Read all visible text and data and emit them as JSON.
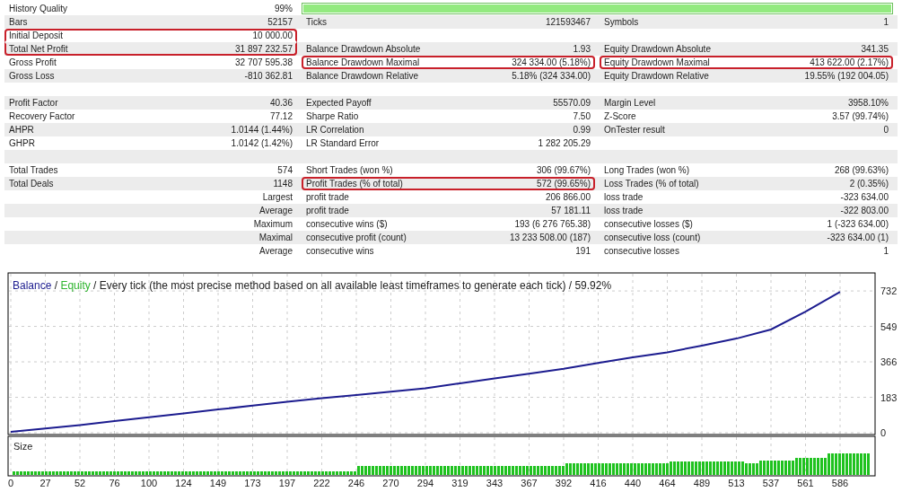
{
  "report": {
    "rows": [
      {
        "cells": [
          {
            "kind": "stat",
            "label": "History Quality",
            "value": "99%",
            "highlighted": false
          },
          {
            "kind": "bar",
            "level": 1
          }
        ]
      },
      {
        "cells": [
          {
            "kind": "stat",
            "label": "Bars",
            "value": "52157",
            "highlighted": false
          },
          {
            "kind": "stat",
            "label": "Ticks",
            "value": "121593467",
            "highlighted": false
          },
          {
            "kind": "stat",
            "label": "Symbols",
            "value": "1",
            "highlighted": false
          }
        ]
      },
      {
        "cells": [
          {
            "kind": "stat",
            "label": "Initial Deposit",
            "value": "10 000.00",
            "highlighted": true
          },
          {
            "kind": "blank"
          },
          {
            "kind": "blank"
          }
        ]
      },
      {
        "cells": [
          {
            "kind": "stat",
            "label": "Total Net Profit",
            "value": "31 897 232.57",
            "highlighted": true
          },
          {
            "kind": "stat",
            "label": "Balance Drawdown Absolute",
            "value": "1.93",
            "highlighted": false
          },
          {
            "kind": "stat",
            "label": "Equity Drawdown Absolute",
            "value": "341.35",
            "highlighted": false
          }
        ]
      },
      {
        "cells": [
          {
            "kind": "stat",
            "label": "Gross Profit",
            "value": "32 707 595.38",
            "highlighted": false
          },
          {
            "kind": "stat",
            "label": "Balance Drawdown Maximal",
            "value": "324 334.00 (5.18%)",
            "highlighted": true
          },
          {
            "kind": "stat",
            "label": "Equity Drawdown Maximal",
            "value": "413 622.00 (2.17%)",
            "highlighted": true
          }
        ]
      },
      {
        "cells": [
          {
            "kind": "stat",
            "label": "Gross Loss",
            "value": "-810 362.81",
            "highlighted": false
          },
          {
            "kind": "stat",
            "label": "Balance Drawdown Relative",
            "value": "5.18% (324 334.00)",
            "highlighted": false
          },
          {
            "kind": "stat",
            "label": "Equity Drawdown Relative",
            "value": "19.55% (192 004.05)",
            "highlighted": false
          }
        ]
      },
      {
        "cells": [
          {
            "kind": "blank"
          },
          {
            "kind": "blank"
          },
          {
            "kind": "blank"
          }
        ]
      },
      {
        "cells": [
          {
            "kind": "stat",
            "label": "Profit Factor",
            "value": "40.36",
            "highlighted": false
          },
          {
            "kind": "stat",
            "label": "Expected Payoff",
            "value": "55570.09",
            "highlighted": false
          },
          {
            "kind": "stat",
            "label": "Margin Level",
            "value": "3958.10%",
            "highlighted": false
          }
        ]
      },
      {
        "cells": [
          {
            "kind": "stat",
            "label": "Recovery Factor",
            "value": "77.12",
            "highlighted": false
          },
          {
            "kind": "stat",
            "label": "Sharpe Ratio",
            "value": "7.50",
            "highlighted": false
          },
          {
            "kind": "stat",
            "label": "Z-Score",
            "value": "3.57 (99.74%)",
            "highlighted": false
          }
        ]
      },
      {
        "cells": [
          {
            "kind": "stat",
            "label": "AHPR",
            "value": "1.0144 (1.44%)",
            "highlighted": false
          },
          {
            "kind": "stat",
            "label": "LR Correlation",
            "value": "0.99",
            "highlighted": false
          },
          {
            "kind": "stat",
            "label": "OnTester result",
            "value": "0",
            "highlighted": false
          }
        ]
      },
      {
        "cells": [
          {
            "kind": "stat",
            "label": "GHPR",
            "value": "1.0142 (1.42%)",
            "highlighted": false
          },
          {
            "kind": "stat",
            "label": "LR Standard Error",
            "value": "1 282 205.29",
            "highlighted": false
          },
          {
            "kind": "blank"
          }
        ]
      },
      {
        "cells": [
          {
            "kind": "blank"
          },
          {
            "kind": "blank"
          },
          {
            "kind": "blank"
          }
        ]
      },
      {
        "cells": [
          {
            "kind": "stat",
            "label": "Total Trades",
            "value": "574",
            "highlighted": false
          },
          {
            "kind": "stat",
            "label": "Short Trades (won %)",
            "value": "306 (99.67%)",
            "highlighted": false
          },
          {
            "kind": "stat",
            "label": "Long Trades (won %)",
            "value": "268 (99.63%)",
            "highlighted": false
          }
        ]
      },
      {
        "cells": [
          {
            "kind": "stat",
            "label": "Total Deals",
            "value": "1148",
            "highlighted": false
          },
          {
            "kind": "stat",
            "label": "Profit Trades (% of total)",
            "value": "572 (99.65%)",
            "highlighted": true
          },
          {
            "kind": "stat",
            "label": "Loss Trades (% of total)",
            "value": "2 (0.35%)",
            "highlighted": false
          }
        ]
      },
      {
        "cells": [
          {
            "kind": "caption",
            "label": "Largest"
          },
          {
            "kind": "stat",
            "label": "profit trade",
            "value": "206 866.00",
            "highlighted": false
          },
          {
            "kind": "stat",
            "label": "loss trade",
            "value": "-323 634.00",
            "highlighted": false
          }
        ]
      },
      {
        "cells": [
          {
            "kind": "caption",
            "label": "Average"
          },
          {
            "kind": "stat",
            "label": "profit trade",
            "value": "57 181.11",
            "highlighted": false
          },
          {
            "kind": "stat",
            "label": "loss trade",
            "value": "-322 803.00",
            "highlighted": false
          }
        ]
      },
      {
        "cells": [
          {
            "kind": "caption",
            "label": "Maximum"
          },
          {
            "kind": "stat",
            "label": "consecutive wins ($)",
            "value": "193 (6 276 765.38)",
            "highlighted": false
          },
          {
            "kind": "stat",
            "label": "consecutive losses ($)",
            "value": "1 (-323 634.00)",
            "highlighted": false
          }
        ]
      },
      {
        "cells": [
          {
            "kind": "caption",
            "label": "Maximal"
          },
          {
            "kind": "stat",
            "label": "consecutive profit (count)",
            "value": "13 233 508.00 (187)",
            "highlighted": false
          },
          {
            "kind": "stat",
            "label": "consecutive loss (count)",
            "value": "-323 634.00 (1)",
            "highlighted": false
          }
        ]
      },
      {
        "cells": [
          {
            "kind": "caption",
            "label": "Average"
          },
          {
            "kind": "stat",
            "label": "consecutive wins",
            "value": "191",
            "highlighted": false
          },
          {
            "kind": "stat",
            "label": "consecutive losses",
            "value": "1",
            "highlighted": false
          }
        ]
      }
    ]
  },
  "graph": {
    "separator": "/",
    "mode": "Every tick (the most precise method based on all available least timeframes to generate each tick)",
    "quality": "59.92%",
    "size_label": "Size",
    "chart_data": {
      "type": "line",
      "categories": [
        "0",
        "27",
        "52",
        "76",
        "100",
        "124",
        "149",
        "173",
        "197",
        "222",
        "246",
        "270",
        "294",
        "319",
        "343",
        "367",
        "392",
        "416",
        "440",
        "464",
        "489",
        "513",
        "537",
        "561",
        "586"
      ],
      "series": [
        {
          "name": "Balance",
          "color": "#1c1c8f",
          "values": [
            5,
            22,
            40,
            60,
            80,
            100,
            120,
            140,
            160,
            178,
            195,
            212,
            230,
            255,
            280,
            305,
            330,
            360,
            390,
            415,
            450,
            486,
            533,
            625,
            727
          ]
        },
        {
          "name": "Equity",
          "color": "#2fb52f",
          "values": [
            null,
            null,
            null,
            null,
            null,
            null,
            null,
            null,
            null,
            null,
            null,
            null,
            null,
            null,
            null,
            null,
            null,
            null,
            null,
            null,
            null,
            null,
            null,
            null,
            null
          ]
        }
      ],
      "ylim": [
        0,
        825
      ],
      "yticks": [
        0,
        183,
        366,
        549,
        732
      ],
      "grid": true
    }
  }
}
